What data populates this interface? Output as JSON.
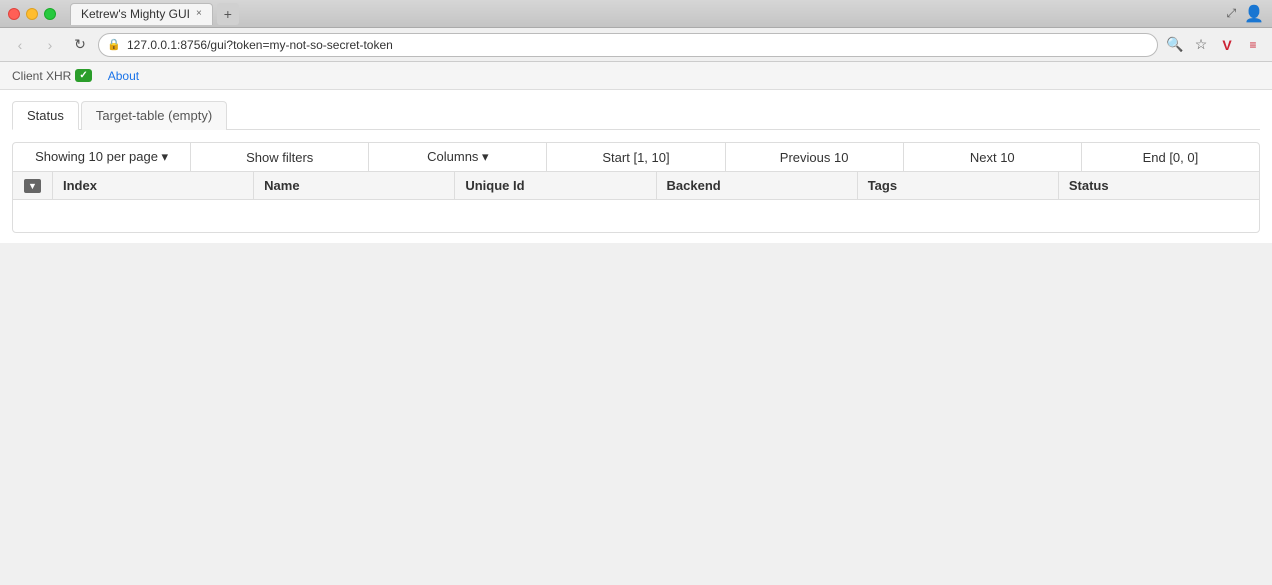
{
  "titlebar": {
    "tab_title": "Ketrew's Mighty GUI",
    "tab_close": "×",
    "new_tab_symbol": "+"
  },
  "navbar": {
    "back": "‹",
    "forward": "›",
    "refresh": "↻",
    "url": "127.0.0.1:8756/gui?token=my-not-so-secret-token",
    "search_icon": "🔍",
    "star_icon": "☆"
  },
  "bookmarks": {
    "client_xhr_label": "Client XHR",
    "client_xhr_badge": "✓",
    "about_label": "About"
  },
  "tabs": [
    {
      "label": "Status",
      "active": true
    },
    {
      "label": "Target-table (empty)",
      "active": false
    }
  ],
  "toolbar": {
    "per_page_label": "Showing 10 per page ▾",
    "show_filters_label": "Show filters",
    "columns_label": "Columns ▾",
    "start_label": "Start [1, 10]",
    "previous_label": "Previous 10",
    "next_label": "Next 10",
    "end_label": "End [0, 0]"
  },
  "table_headers": [
    {
      "key": "index",
      "label": "Index"
    },
    {
      "key": "name",
      "label": "Name"
    },
    {
      "key": "unique_id",
      "label": "Unique Id"
    },
    {
      "key": "backend",
      "label": "Backend"
    },
    {
      "key": "tags",
      "label": "Tags"
    },
    {
      "key": "status",
      "label": "Status"
    }
  ]
}
